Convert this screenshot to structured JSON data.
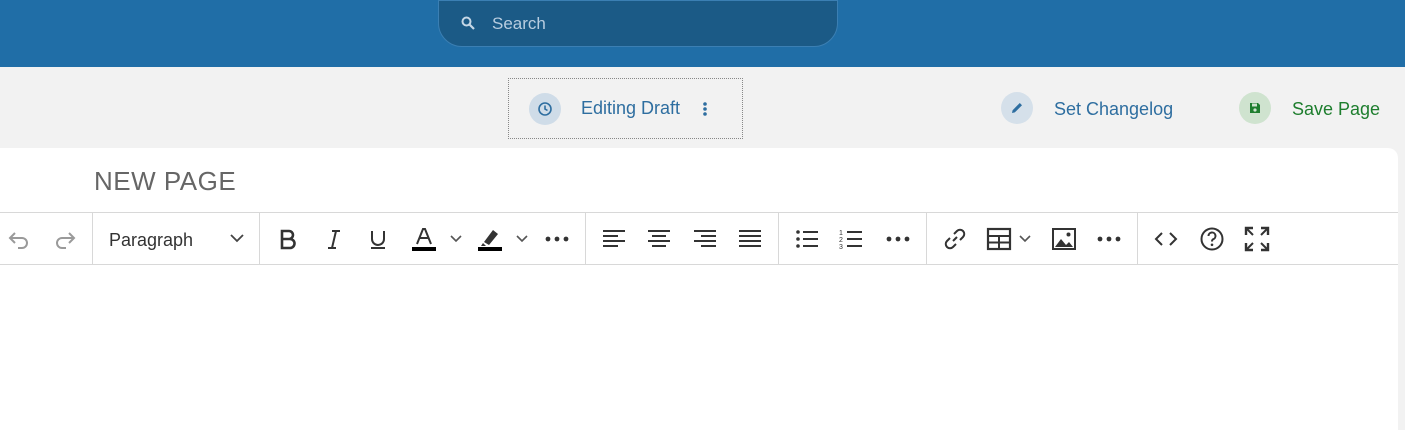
{
  "search": {
    "placeholder": "Search"
  },
  "actions": {
    "draft_label": "Editing Draft",
    "changelog_label": "Set Changelog",
    "save_label": "Save Page"
  },
  "editor": {
    "title": "NEW PAGE",
    "block_format": "Paragraph"
  },
  "toolbar_buttons": [
    "undo-icon",
    "redo-icon",
    "bold-icon",
    "italic-icon",
    "underline-icon",
    "text-color-icon",
    "highlight-icon",
    "more-icon",
    "align-left-icon",
    "align-center-icon",
    "align-right-icon",
    "justify-icon",
    "bullet-list-icon",
    "numbered-list-icon",
    "more-icon",
    "link-icon",
    "table-icon",
    "image-icon",
    "more-icon",
    "source-code-icon",
    "help-icon",
    "fullscreen-icon"
  ],
  "colors": {
    "topbar": "#206ea7",
    "accent_blue": "#2e6ea0",
    "save_green": "#1e7e2e"
  }
}
